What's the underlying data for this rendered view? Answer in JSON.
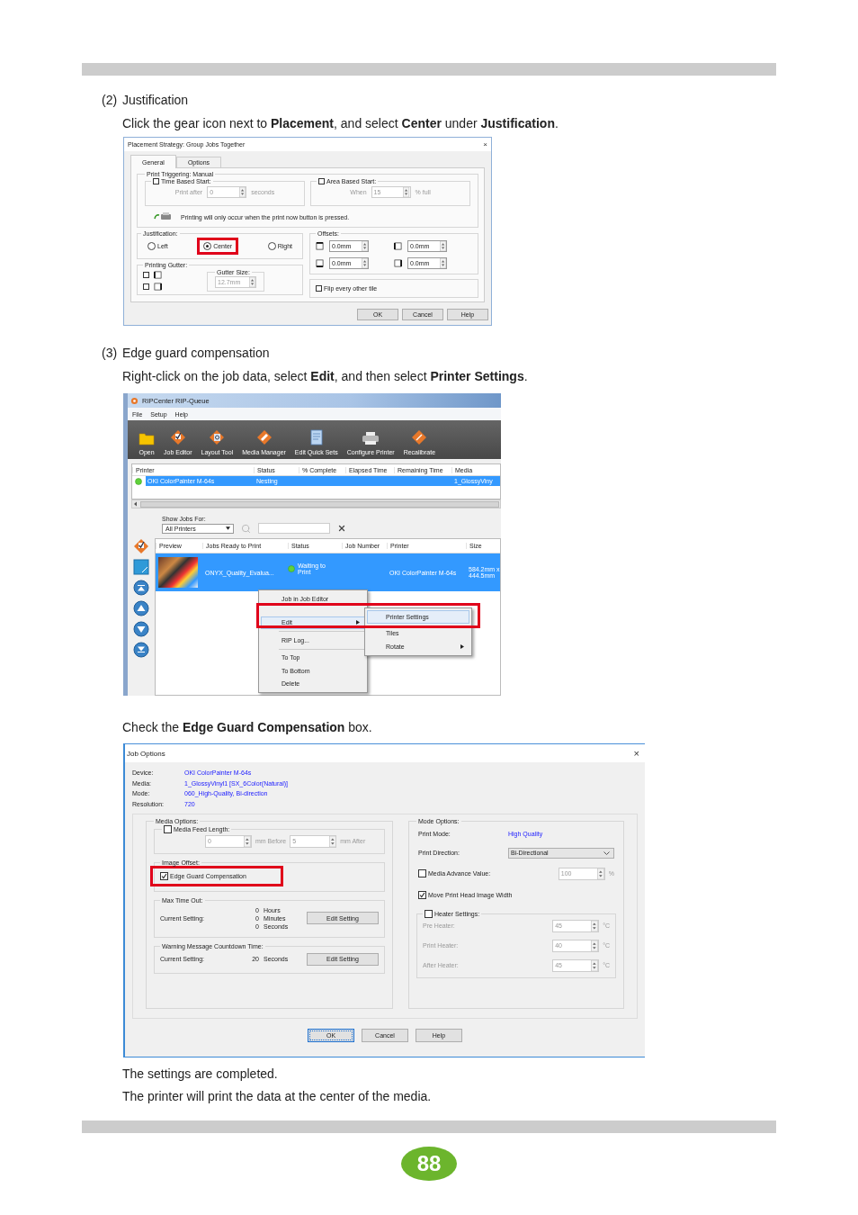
{
  "section_justification": {
    "number": "(2)",
    "title": "Justification",
    "instruction": "Click the gear icon next to **Placement**, and select **Center** under **Justification**."
  },
  "placement_dialog": {
    "title": "Placement Strategy: Group Jobs Together",
    "close": "×",
    "tabs": [
      {
        "label": "General",
        "selected": true
      },
      {
        "label": "Options",
        "selected": false
      }
    ],
    "print_triggering": {
      "title": "Print Triggering: Manual",
      "starts": [
        {
          "label": "Time Based Start:",
          "checked": false,
          "prefix": "Print after",
          "value": "0",
          "unit": "seconds"
        },
        {
          "label": "Area Based Start:",
          "checked": false,
          "prefix": "When",
          "value": "15",
          "unit": "% full"
        }
      ],
      "note": "Printing will only occur when the print now button is pressed."
    },
    "justification": {
      "title": "Justification:",
      "options": [
        {
          "label": "Left",
          "selected": false,
          "highlighted": false
        },
        {
          "label": "Center",
          "selected": true,
          "highlighted": true
        },
        {
          "label": "Right",
          "selected": false,
          "highlighted": false
        }
      ]
    },
    "printing_gutter": {
      "title": "Printing Gutter:",
      "options": [
        {
          "checked": false
        },
        {
          "checked": false
        }
      ],
      "size_label": "Gutter Size:",
      "size": "12.7mm"
    },
    "offsets": {
      "title": "Offsets:",
      "values": [
        "0.0mm",
        "0.0mm",
        "0.0mm",
        "0.0mm"
      ]
    },
    "flip": {
      "label": "Flip every other tile",
      "checked": false
    },
    "buttons": [
      "OK",
      "Cancel",
      "Help"
    ]
  },
  "section_edge_guard": {
    "number": "(3)",
    "title": "Edge guard compensation",
    "instruction": "Right-click on the job data, select **Edit**, and then select **Printer Settings**."
  },
  "rip_queue": {
    "title": "RIPCenter RIP-Queue",
    "menu": [
      "File",
      "Setup",
      "Help"
    ],
    "toolbar": [
      "Open",
      "Job Editor",
      "Layout Tool",
      "Media Manager",
      "Edit Quick Sets",
      "Configure Printer",
      "Recalibrate"
    ],
    "printer_table": {
      "columns": [
        "Printer",
        "Status",
        "% Complete",
        "Elapsed Time",
        "Remaining Time",
        "Media"
      ],
      "rows": [
        {
          "printer": "OKI ColorPainter M-64s",
          "status": "Nesting",
          "media": "1_GlossyViny",
          "selected": true
        }
      ]
    },
    "show_jobs": {
      "label": "Show Jobs For:",
      "value": "All Printers"
    },
    "jobs_table": {
      "columns": [
        "Preview",
        "Jobs Ready to Print",
        "Status",
        "Job Number",
        "Printer",
        "Size"
      ],
      "rows": [
        {
          "name": "ONYX_Quality_Evalua...",
          "status": "Waiting to Print",
          "printer": "OKI ColorPainter M-64s",
          "size": "584.2mm x 444.5mm",
          "selected": true
        }
      ]
    },
    "context_menu": [
      {
        "label": "Job in Job Editor",
        "highlighted": false,
        "submenu": false
      },
      {
        "label": "Edit",
        "highlighted": true,
        "submenu": true
      },
      {
        "label": "RIP Log...",
        "highlighted": false,
        "submenu": false
      },
      {
        "label": "To Top",
        "highlighted": false,
        "submenu": false
      },
      {
        "label": "To Bottom",
        "highlighted": false,
        "submenu": false
      },
      {
        "label": "Delete",
        "highlighted": false,
        "submenu": false
      }
    ],
    "submenu": [
      {
        "label": "Printer Settings",
        "highlighted": true,
        "submenu": false
      },
      {
        "label": "Tiles",
        "highlighted": false,
        "submenu": false
      },
      {
        "label": "Rotate",
        "highlighted": false,
        "submenu": true
      }
    ]
  },
  "check_text": "Check the **Edge Guard Compensation** box.",
  "job_options": {
    "title": "Job Options",
    "close": "×",
    "info": [
      {
        "label": "Device:",
        "value": "OKI ColorPainter M-64s"
      },
      {
        "label": "Media:",
        "value": "1_GlossyVinyl1 [SX_6Color(Natural)]"
      },
      {
        "label": "Mode:",
        "value": "060_High-Quality, Bi-direction"
      },
      {
        "label": "Resolution:",
        "value": "720"
      }
    ],
    "media_options": {
      "title": "Media Options:",
      "feed_length": {
        "label": "Media Feed Length:",
        "checked": false,
        "before": "0",
        "before_unit": "mm Before",
        "after": "5",
        "after_unit": "mm After"
      },
      "image_offset": {
        "title": "Image Offset:",
        "label": "Edge Guard Compensation",
        "checked": true,
        "highlighted": true
      }
    },
    "max_time_out": {
      "title": "Max Time Out:",
      "label": "Current Setting:",
      "values": [
        {
          "value": "0",
          "unit": "Hours"
        },
        {
          "value": "0",
          "unit": "Minutes"
        },
        {
          "value": "0",
          "unit": "Seconds"
        }
      ],
      "button": "Edit Setting"
    },
    "warning": {
      "title": "Warning Message Countdown Time:",
      "label": "Current Setting:",
      "values": [
        {
          "value": "20",
          "unit": "Seconds"
        }
      ],
      "button": "Edit Setting"
    },
    "mode_options": {
      "title": "Mode Options:",
      "print_mode_label": "Print Mode:",
      "print_mode": "High Quality",
      "direction_label": "Print Direction:",
      "direction": "Bi-Directional",
      "media_advance": {
        "label": "Media Advance Value:",
        "checked": false,
        "value": "100",
        "unit": "%"
      },
      "move_head": {
        "label": "Move Print Head Image Width",
        "checked": true
      },
      "heater": {
        "label": "Heater Settings:",
        "checked": false,
        "rows": [
          {
            "label": "Pre Heater:",
            "value": "45",
            "unit": "°C"
          },
          {
            "label": "Print Heater:",
            "value": "40",
            "unit": "°C"
          },
          {
            "label": "After Heater:",
            "value": "45",
            "unit": "°C"
          }
        ]
      }
    },
    "buttons": [
      {
        "label": "OK",
        "focused": true
      },
      {
        "label": "Cancel",
        "focused": false
      },
      {
        "label": "Help",
        "focused": false
      }
    ]
  },
  "closing": [
    "The settings are completed.",
    "The printer will print the data at the center of the media."
  ],
  "page_number": "88"
}
